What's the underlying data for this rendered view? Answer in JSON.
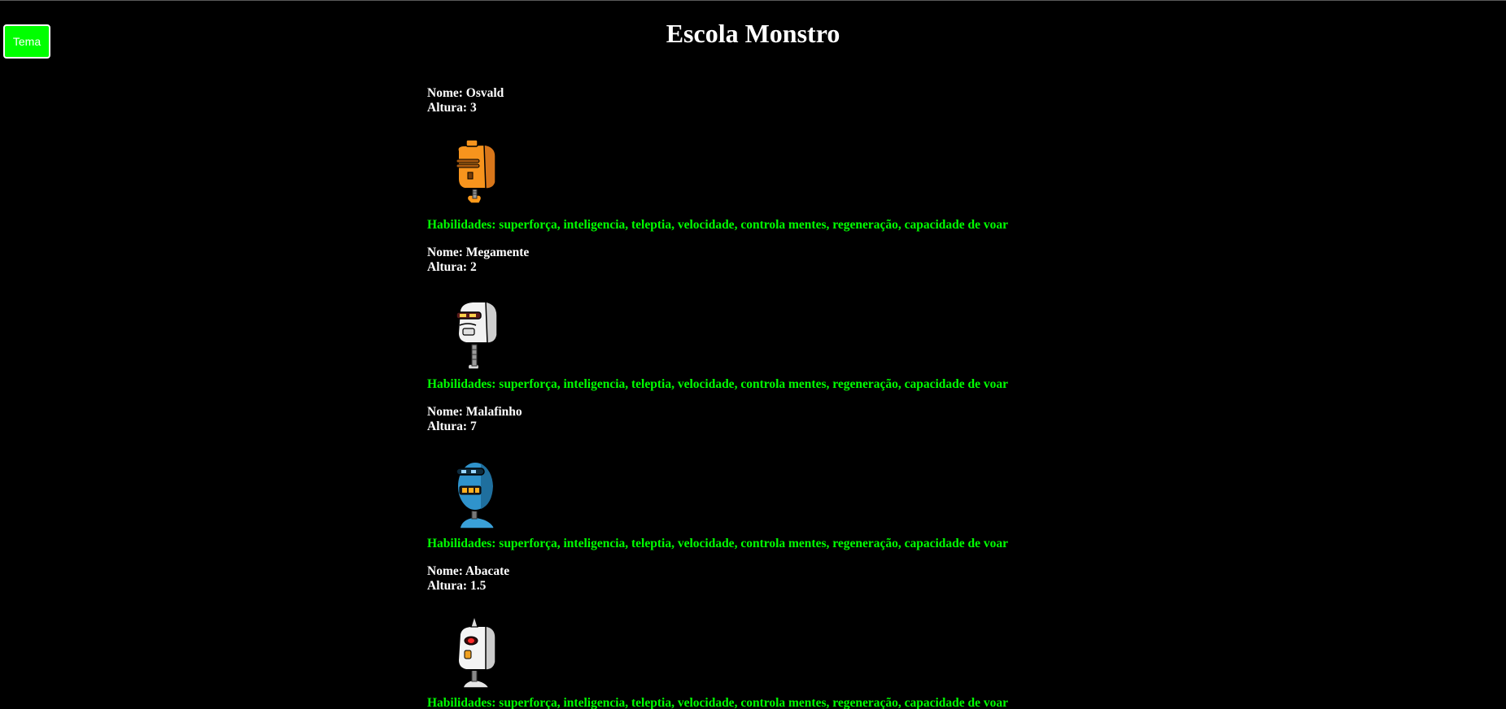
{
  "header": {
    "title": "Escola Monstro",
    "theme_button": "Tema"
  },
  "colors": {
    "background": "#000000",
    "text": "#ffffff",
    "accent": "#00ff00"
  },
  "monsters": [
    {
      "name": "Nome: Osvald",
      "height": "Altura: 3",
      "image": "orange-robot-icon",
      "abilities": "Habilidades: superforça, inteligencia, teleptia, velocidade, controla mentes, regeneração, capacidade de voar"
    },
    {
      "name": "Nome: Megamente",
      "height": "Altura: 2",
      "image": "white-robot-icon",
      "abilities": "Habilidades: superforça, inteligencia, teleptia, velocidade, controla mentes, regeneração, capacidade de voar"
    },
    {
      "name": "Nome: Malafinho",
      "height": "Altura: 7",
      "image": "blue-robot-icon",
      "abilities": "Habilidades: superforça, inteligencia, teleptia, velocidade, controla mentes, regeneração, capacidade de voar"
    },
    {
      "name": "Nome: Abacate",
      "height": "Altura: 1.5",
      "image": "horned-robot-icon",
      "abilities": "Habilidades: superforça, inteligencia, teleptia, velocidade, controla mentes, regeneração, capacidade de voar"
    }
  ]
}
